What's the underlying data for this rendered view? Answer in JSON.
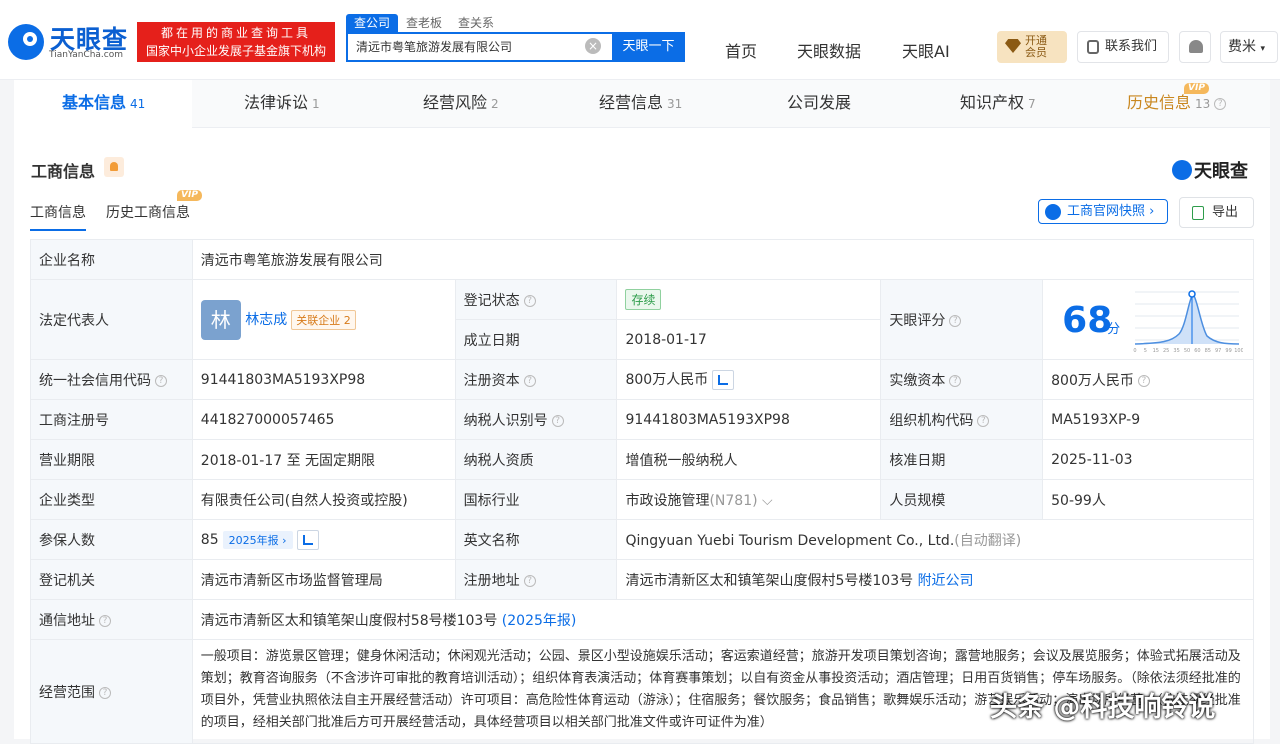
{
  "header": {
    "logo_text": "天眼查",
    "logo_sub": "TianYanCha.com",
    "slogan_line1": "都在用的商业查询工具",
    "slogan_line2": "国家中小企业发展子基金旗下机构",
    "search_tabs": [
      "查公司",
      "查老板",
      "查关系"
    ],
    "search_value": "清远市粤笔旅游发展有限公司",
    "search_button": "天眼一下",
    "nav": [
      "首页",
      "天眼数据",
      "天眼AI"
    ],
    "vip_line1": "开通",
    "vip_line2": "会员",
    "contact": "联系我们",
    "user": "费米"
  },
  "tabs": [
    {
      "label": "基本信息",
      "count": "41"
    },
    {
      "label": "法律诉讼",
      "count": "1"
    },
    {
      "label": "经营风险",
      "count": "2"
    },
    {
      "label": "经营信息",
      "count": "31"
    },
    {
      "label": "公司发展",
      "count": ""
    },
    {
      "label": "知识产权",
      "count": "7"
    },
    {
      "label": "历史信息",
      "count": "13"
    }
  ],
  "vip_badge": "VIP",
  "section": {
    "title": "工商信息",
    "brand": "天眼查",
    "subtabs": [
      "工商信息",
      "历史工商信息"
    ],
    "snapshot_button": "工商官网快照",
    "export_button": "导出"
  },
  "info": {
    "company_name_k": "企业名称",
    "company_name": "清远市粤笔旅游发展有限公司",
    "legal_rep_k": "法定代表人",
    "avatar": "林",
    "legal_rep": "林志成",
    "assoc": "关联企业",
    "assoc_count": "2",
    "reg_status_k": "登记状态",
    "reg_status": "存续",
    "found_date_k": "成立日期",
    "found_date": "2018-01-17",
    "score_k": "天眼评分",
    "score": "68",
    "score_unit": "分",
    "credit_code_k": "统一社会信用代码",
    "credit_code": "91441803MA5193XP98",
    "reg_capital_k": "注册资本",
    "reg_capital": "800万人民币",
    "paid_capital_k": "实缴资本",
    "paid_capital": "800万人民币",
    "reg_no_k": "工商注册号",
    "reg_no": "441827000057465",
    "tax_id_k": "纳税人识别号",
    "tax_id": "91441803MA5193XP98",
    "org_code_k": "组织机构代码",
    "org_code": "MA5193XP-9",
    "term_k": "营业期限",
    "term": "2018-01-17 至 无固定期限",
    "tax_qual_k": "纳税人资质",
    "tax_qual": "增值税一般纳税人",
    "approve_date_k": "核准日期",
    "approve_date": "2025-11-03",
    "type_k": "企业类型",
    "type": "有限责任公司(自然人投资或控股)",
    "industry_k": "国标行业",
    "industry": "市政设施管理",
    "industry_code": "(N781)",
    "staff_k": "人员规模",
    "staff": "50-99人",
    "insured_k": "参保人数",
    "insured": "85",
    "insured_report": "2025年报",
    "en_name_k": "英文名称",
    "en_name": "Qingyuan Yuebi Tourism Development Co., Ltd.",
    "en_auto": "(自动翻译)",
    "authority_k": "登记机关",
    "authority": "清远市清新区市场监督管理局",
    "reg_addr_k": "注册地址",
    "reg_addr": "清远市清新区太和镇笔架山度假村5号楼103号",
    "nearby": "附近公司",
    "contact_addr_k": "通信地址",
    "contact_addr": "清远市清新区太和镇笔架山度假村58号楼103号",
    "contact_addr_report": "(2025年报)",
    "scope_k": "经营范围",
    "scope": "一般项目：游览景区管理；健身休闲活动；休闲观光活动；公园、景区小型设施娱乐活动；客运索道经营；旅游开发项目策划咨询；露营地服务；会议及展览服务；体验式拓展活动及策划；教育咨询服务（不含涉许可审批的教育培训活动）；组织体育表演活动；体育赛事策划；以自有资金从事投资活动；酒店管理；日用百货销售；停车场服务。（除依法须经批准的项目外，凭营业执照依法自主开展经营活动）许可项目：高危险性体育运动（游泳）；住宿服务；餐饮服务；食品销售；歌舞娱乐活动；游艺娱乐活动；演出场所经营。（依法须经批准的项目，经相关部门批准后方可开展经营活动，具体经营项目以相关部门批准文件或许可证件为准）"
  },
  "score_chart": {
    "ticks": [
      "0",
      "5",
      "15",
      "25",
      "35",
      "50",
      "60",
      "85",
      "97",
      "99",
      "100"
    ],
    "marker": 68
  },
  "watermark": "头条 @科技响铃说"
}
